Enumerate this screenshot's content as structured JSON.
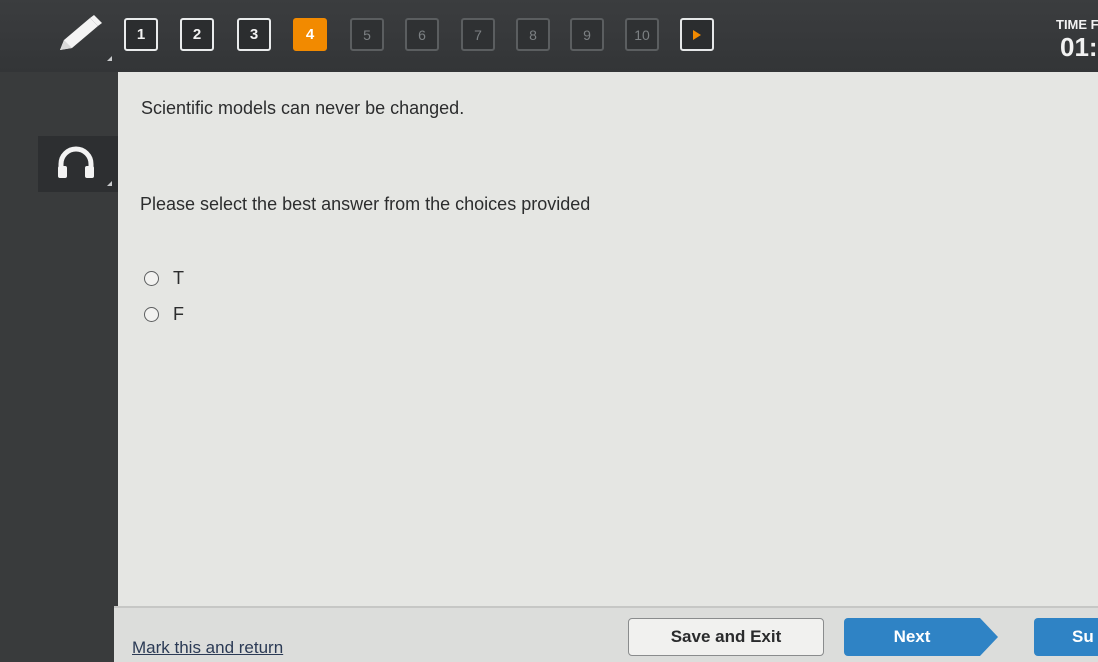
{
  "toolbar": {
    "pencil_icon": "pencil-icon",
    "questions": [
      {
        "label": "1",
        "state": "answered"
      },
      {
        "label": "2",
        "state": "answered"
      },
      {
        "label": "3",
        "state": "answered"
      },
      {
        "label": "4",
        "state": "current"
      },
      {
        "label": "5",
        "state": "unanswered"
      },
      {
        "label": "6",
        "state": "unanswered"
      },
      {
        "label": "7",
        "state": "unanswered"
      },
      {
        "label": "8",
        "state": "unanswered"
      },
      {
        "label": "9",
        "state": "unanswered"
      },
      {
        "label": "10",
        "state": "unanswered"
      }
    ],
    "next_icon": "play-arrow-icon",
    "timer_label": "TIME F",
    "timer_value": "01:"
  },
  "sidebar": {
    "audio_icon": "headphones-icon"
  },
  "main": {
    "question_text": "Scientific models can never be changed.",
    "instructions": "Please select the best answer from the choices provided",
    "options": [
      {
        "label": "T",
        "selected": false
      },
      {
        "label": "F",
        "selected": false
      }
    ]
  },
  "footer": {
    "mark_label": "Mark this and return",
    "save_label": "Save and Exit",
    "next_label": "Next",
    "submit_label": "Su"
  },
  "colors": {
    "accent": "#f28a00",
    "next_button": "#2f83c5",
    "toolbar_bg": "#38393b",
    "content_bg": "#e5e6e3"
  }
}
